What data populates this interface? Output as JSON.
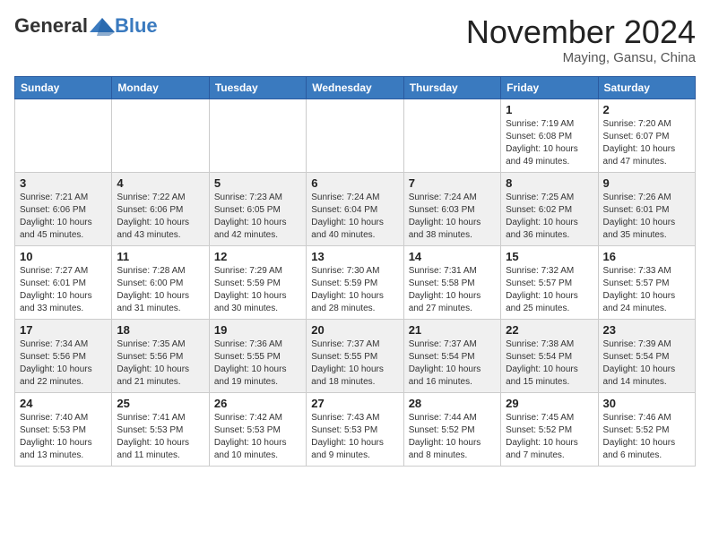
{
  "header": {
    "logo_general": "General",
    "logo_blue": "Blue",
    "month_title": "November 2024",
    "location": "Maying, Gansu, China"
  },
  "weekdays": [
    "Sunday",
    "Monday",
    "Tuesday",
    "Wednesday",
    "Thursday",
    "Friday",
    "Saturday"
  ],
  "weeks": [
    [
      {
        "day": "",
        "info": ""
      },
      {
        "day": "",
        "info": ""
      },
      {
        "day": "",
        "info": ""
      },
      {
        "day": "",
        "info": ""
      },
      {
        "day": "",
        "info": ""
      },
      {
        "day": "1",
        "info": "Sunrise: 7:19 AM\nSunset: 6:08 PM\nDaylight: 10 hours and 49 minutes."
      },
      {
        "day": "2",
        "info": "Sunrise: 7:20 AM\nSunset: 6:07 PM\nDaylight: 10 hours and 47 minutes."
      }
    ],
    [
      {
        "day": "3",
        "info": "Sunrise: 7:21 AM\nSunset: 6:06 PM\nDaylight: 10 hours and 45 minutes."
      },
      {
        "day": "4",
        "info": "Sunrise: 7:22 AM\nSunset: 6:06 PM\nDaylight: 10 hours and 43 minutes."
      },
      {
        "day": "5",
        "info": "Sunrise: 7:23 AM\nSunset: 6:05 PM\nDaylight: 10 hours and 42 minutes."
      },
      {
        "day": "6",
        "info": "Sunrise: 7:24 AM\nSunset: 6:04 PM\nDaylight: 10 hours and 40 minutes."
      },
      {
        "day": "7",
        "info": "Sunrise: 7:24 AM\nSunset: 6:03 PM\nDaylight: 10 hours and 38 minutes."
      },
      {
        "day": "8",
        "info": "Sunrise: 7:25 AM\nSunset: 6:02 PM\nDaylight: 10 hours and 36 minutes."
      },
      {
        "day": "9",
        "info": "Sunrise: 7:26 AM\nSunset: 6:01 PM\nDaylight: 10 hours and 35 minutes."
      }
    ],
    [
      {
        "day": "10",
        "info": "Sunrise: 7:27 AM\nSunset: 6:01 PM\nDaylight: 10 hours and 33 minutes."
      },
      {
        "day": "11",
        "info": "Sunrise: 7:28 AM\nSunset: 6:00 PM\nDaylight: 10 hours and 31 minutes."
      },
      {
        "day": "12",
        "info": "Sunrise: 7:29 AM\nSunset: 5:59 PM\nDaylight: 10 hours and 30 minutes."
      },
      {
        "day": "13",
        "info": "Sunrise: 7:30 AM\nSunset: 5:59 PM\nDaylight: 10 hours and 28 minutes."
      },
      {
        "day": "14",
        "info": "Sunrise: 7:31 AM\nSunset: 5:58 PM\nDaylight: 10 hours and 27 minutes."
      },
      {
        "day": "15",
        "info": "Sunrise: 7:32 AM\nSunset: 5:57 PM\nDaylight: 10 hours and 25 minutes."
      },
      {
        "day": "16",
        "info": "Sunrise: 7:33 AM\nSunset: 5:57 PM\nDaylight: 10 hours and 24 minutes."
      }
    ],
    [
      {
        "day": "17",
        "info": "Sunrise: 7:34 AM\nSunset: 5:56 PM\nDaylight: 10 hours and 22 minutes."
      },
      {
        "day": "18",
        "info": "Sunrise: 7:35 AM\nSunset: 5:56 PM\nDaylight: 10 hours and 21 minutes."
      },
      {
        "day": "19",
        "info": "Sunrise: 7:36 AM\nSunset: 5:55 PM\nDaylight: 10 hours and 19 minutes."
      },
      {
        "day": "20",
        "info": "Sunrise: 7:37 AM\nSunset: 5:55 PM\nDaylight: 10 hours and 18 minutes."
      },
      {
        "day": "21",
        "info": "Sunrise: 7:37 AM\nSunset: 5:54 PM\nDaylight: 10 hours and 16 minutes."
      },
      {
        "day": "22",
        "info": "Sunrise: 7:38 AM\nSunset: 5:54 PM\nDaylight: 10 hours and 15 minutes."
      },
      {
        "day": "23",
        "info": "Sunrise: 7:39 AM\nSunset: 5:54 PM\nDaylight: 10 hours and 14 minutes."
      }
    ],
    [
      {
        "day": "24",
        "info": "Sunrise: 7:40 AM\nSunset: 5:53 PM\nDaylight: 10 hours and 13 minutes."
      },
      {
        "day": "25",
        "info": "Sunrise: 7:41 AM\nSunset: 5:53 PM\nDaylight: 10 hours and 11 minutes."
      },
      {
        "day": "26",
        "info": "Sunrise: 7:42 AM\nSunset: 5:53 PM\nDaylight: 10 hours and 10 minutes."
      },
      {
        "day": "27",
        "info": "Sunrise: 7:43 AM\nSunset: 5:53 PM\nDaylight: 10 hours and 9 minutes."
      },
      {
        "day": "28",
        "info": "Sunrise: 7:44 AM\nSunset: 5:52 PM\nDaylight: 10 hours and 8 minutes."
      },
      {
        "day": "29",
        "info": "Sunrise: 7:45 AM\nSunset: 5:52 PM\nDaylight: 10 hours and 7 minutes."
      },
      {
        "day": "30",
        "info": "Sunrise: 7:46 AM\nSunset: 5:52 PM\nDaylight: 10 hours and 6 minutes."
      }
    ]
  ]
}
